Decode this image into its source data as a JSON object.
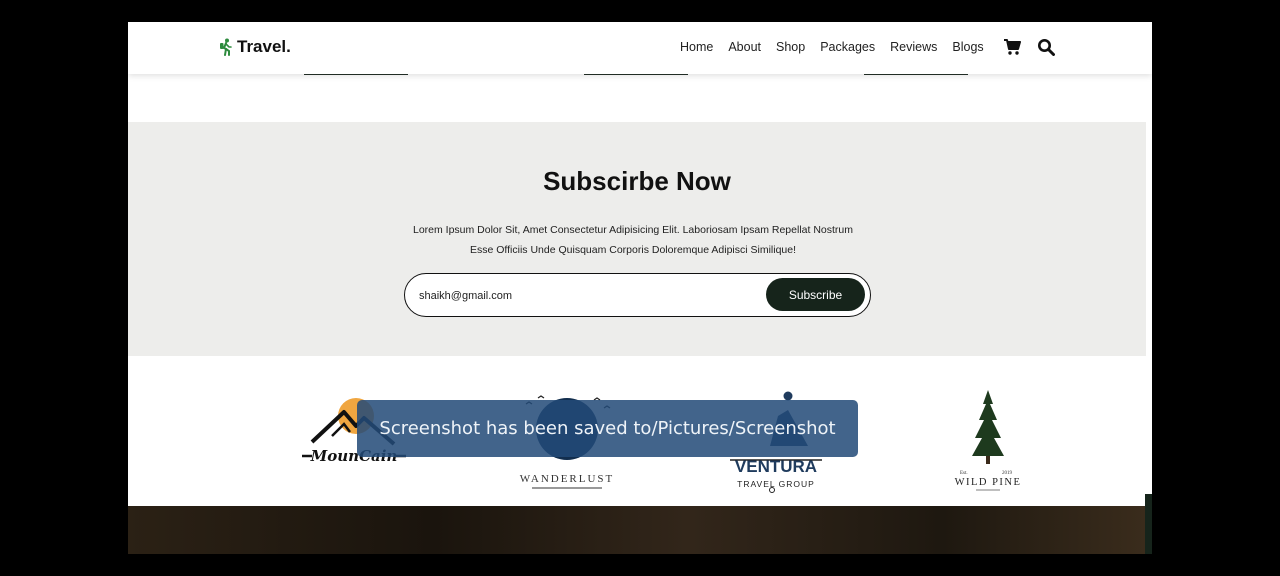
{
  "brand": {
    "name": "Travel.",
    "logo_icon": "hiker-icon",
    "accent": "#2e8b3e"
  },
  "nav": {
    "items": [
      "Home",
      "About",
      "Shop",
      "Packages",
      "Reviews",
      "Blogs"
    ],
    "icons": [
      "cart-icon",
      "search-icon"
    ]
  },
  "subscribe": {
    "title": "Subscirbe Now",
    "text_line1": "Lorem Ipsum Dolor Sit, Amet Consectetur Adipisicing Elit. Laboriosam Ipsam Repellat Nostrum",
    "text_line2": "Esse Officiis Unde Quisquam Corporis Doloremque Adipisci Similique!",
    "input_value": "shaikh@gmail.com",
    "button_label": "Subscribe",
    "background": "#ededeb",
    "button_color": "#16241b"
  },
  "partner_logos": {
    "mountain": "MounCain",
    "wanderlust": "WANDERLUST",
    "ventura_main": "VENTURA",
    "ventura_sub": "TRAVEL GROUP",
    "wild_pine": "WILD PINE",
    "wild_pine_est": "Est.",
    "wild_pine_year": "2019"
  },
  "toast": {
    "message": "Screenshot has been saved to/Pictures/Screenshot",
    "color": "#234b78"
  }
}
